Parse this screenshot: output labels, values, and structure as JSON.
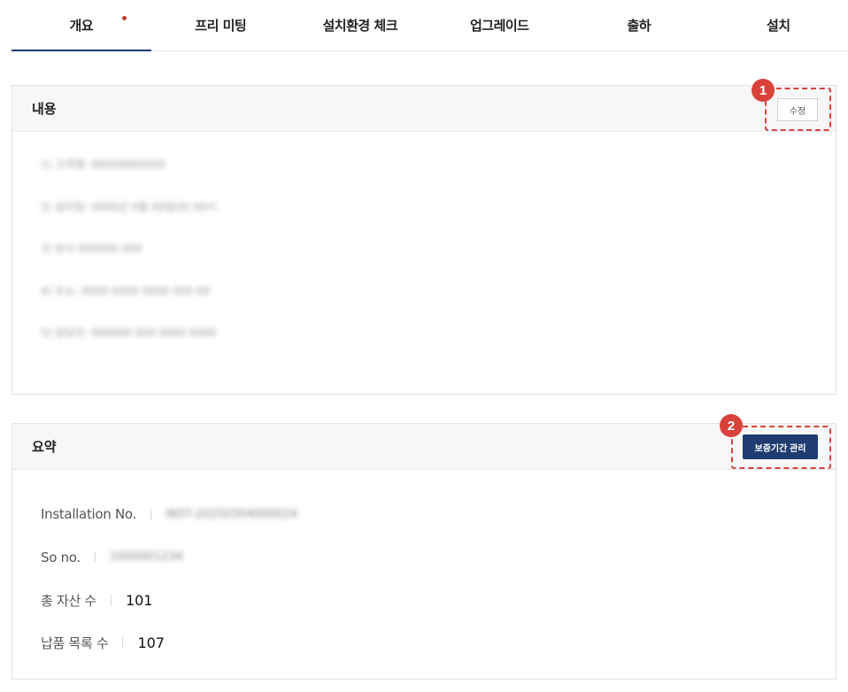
{
  "tabs": [
    {
      "label": "개요",
      "active": true,
      "notify_dot": true
    },
    {
      "label": "프리 미팅",
      "active": false
    },
    {
      "label": "설치환경 체크",
      "active": false
    },
    {
      "label": "업그레이드",
      "active": false
    },
    {
      "label": "출하",
      "active": false
    },
    {
      "label": "설치",
      "active": false
    }
  ],
  "content_panel": {
    "title": "내용",
    "edit_label": "수정",
    "marker": "1",
    "lines": [
      "1) 고객명: 00000000000",
      "2) 설치일: 0000년 0월 00일(0) 00시",
      "3) 본사 000000 000",
      "4) 주소: 0000 0000 0000 000 00",
      "5) 담당자: 000000 000 0000 0000"
    ]
  },
  "summary_panel": {
    "title": "요약",
    "warranty_label": "보증기간 관리",
    "marker": "2",
    "rows": [
      {
        "label": "Installation No.",
        "value": "INST-20250304000024",
        "blurred": true
      },
      {
        "label": "So no.",
        "value": "1000001234",
        "blurred": true
      },
      {
        "label": "총 자산 수",
        "value": "101",
        "blurred": false
      },
      {
        "label": "납품 목록 수",
        "value": "107",
        "blurred": false
      }
    ]
  },
  "colors": {
    "accent": "#1f3a70",
    "highlight": "#d9423a",
    "notify_dot": "#c0392b"
  }
}
